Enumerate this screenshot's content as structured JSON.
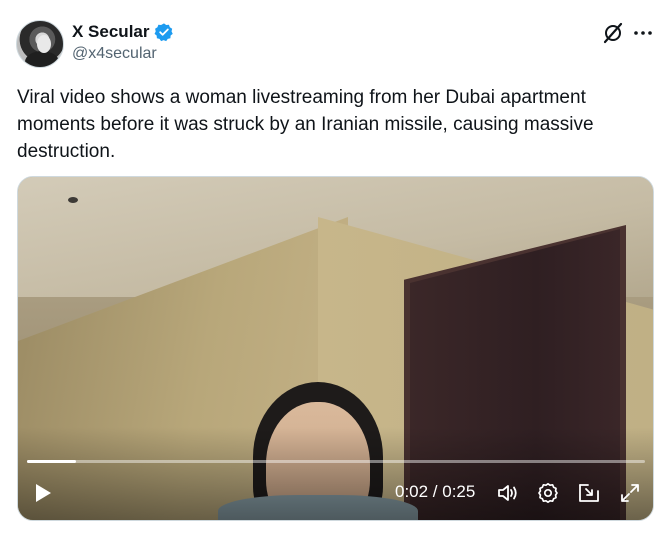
{
  "author": {
    "display_name": "X Secular",
    "handle": "@x4secular",
    "verified_color": "#1d9bf0"
  },
  "post": {
    "text": "Viral video shows a woman livestreaming from her Dubai apartment moments before it was struck by an Iranian missile, causing massive destruction."
  },
  "video": {
    "time_display": "0:02 / 0:25",
    "progress_fraction": 0.08
  },
  "icons": {
    "header": [
      "grok-icon",
      "more-icon"
    ],
    "controls": [
      "play-icon",
      "volume-icon",
      "settings-icon",
      "picture-in-picture-icon",
      "fullscreen-icon"
    ]
  }
}
